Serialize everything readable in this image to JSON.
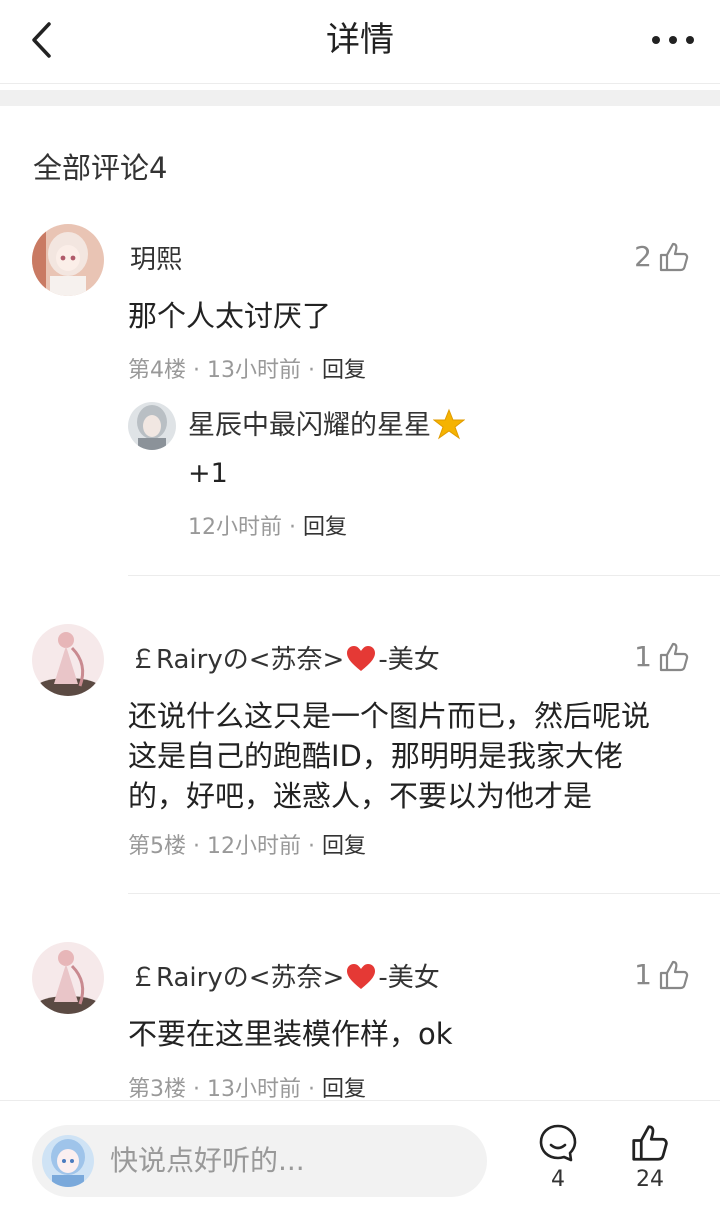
{
  "header": {
    "title": "详情"
  },
  "comments_section": {
    "title": "全部评论4"
  },
  "comments": [
    {
      "author": "玥熙",
      "likes": "2",
      "text": "那个人太讨厌了",
      "floor": "第4楼",
      "time": "13小时前",
      "reply_label": "回复",
      "reply": {
        "author": "星辰中最闪耀的星星",
        "text": "+1",
        "time": "12小时前",
        "reply_label": "回复"
      }
    },
    {
      "author": "￡Rairyの<苏奈>",
      "author_suffix": "-美女",
      "likes": "1",
      "text": "还说什么这只是一个图片而已，然后呢说这是自己的跑酷ID，那明明是我家大佬的，好吧，迷惑人，不要以为他才是",
      "floor": "第5楼",
      "time": "12小时前",
      "reply_label": "回复"
    },
    {
      "author": "￡Rairyの<苏奈>",
      "author_suffix": "-美女",
      "likes": "1",
      "text": "不要在这里装模作样，ok",
      "floor": "第3楼",
      "time": "13小时前",
      "reply_label": "回复"
    }
  ],
  "bottom_bar": {
    "input_placeholder": "快说点好听的...",
    "comment_count": "4",
    "like_count": "24"
  },
  "icons": {
    "back": "chevron-left-icon",
    "more": "more-dots-icon",
    "like": "thumbs-up-icon",
    "star": "star-emoji-icon",
    "heart": "heart-emoji-icon",
    "comment": "comment-bubble-icon"
  },
  "colors": {
    "heart": "#e53935",
    "star": "#f5b301",
    "meta": "#999999"
  }
}
